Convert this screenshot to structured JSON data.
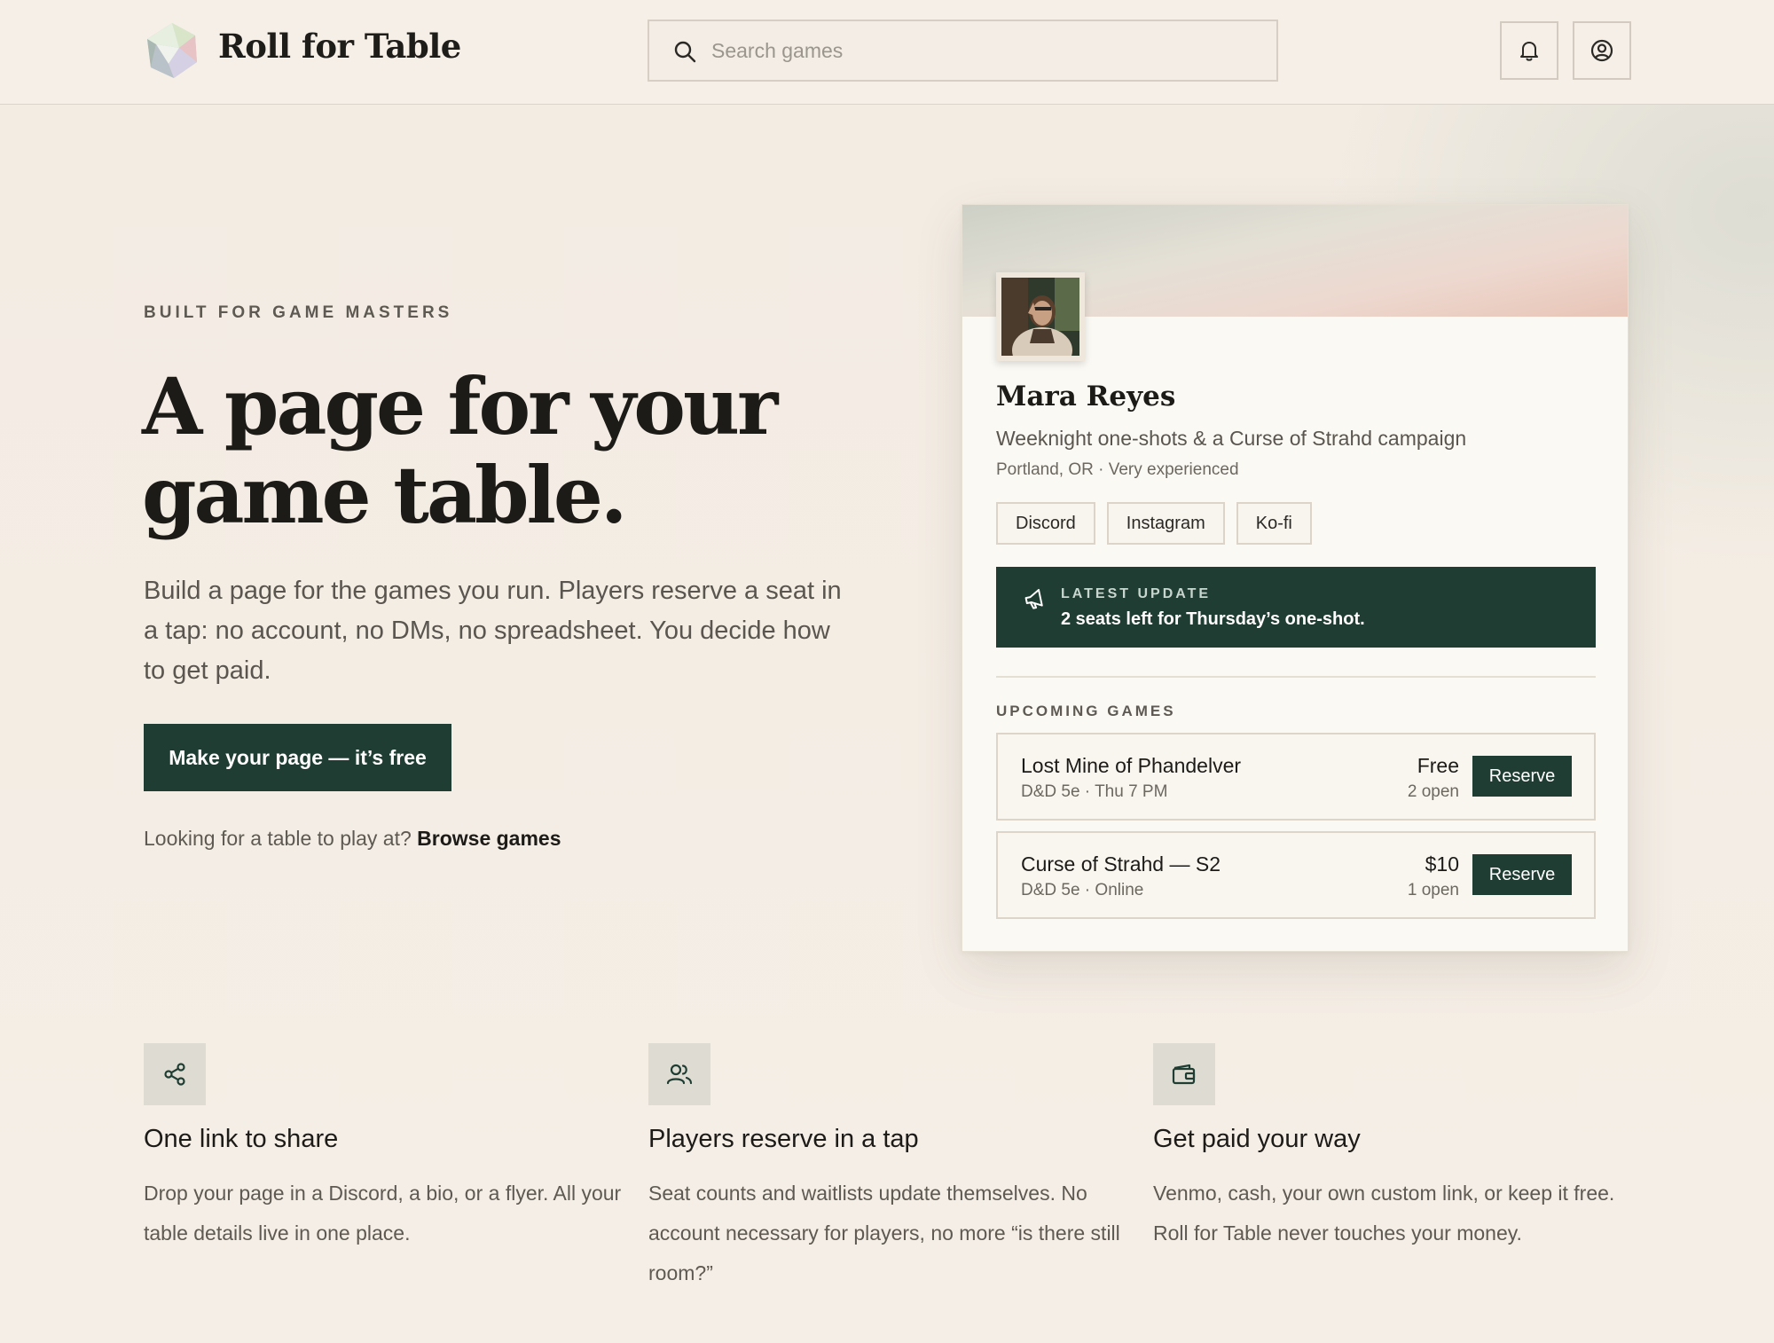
{
  "header": {
    "brand": "Roll for Table",
    "search_placeholder": "Search games"
  },
  "hero": {
    "eyebrow": "BUILT FOR GAME MASTERS",
    "title_line1": "A page for your",
    "title_line2": "game table.",
    "subtitle": "Build a page for the games you run. Players reserve a seat in a tap: no account, no DMs, no spreadsheet. You decide how to get paid.",
    "cta_label": "Make your page — it’s free",
    "browse_prompt": "Looking for a table to play at?",
    "browse_link": "Browse games"
  },
  "profile": {
    "name": "Mara Reyes",
    "tagline": "Weeknight one-shots & a Curse of Strahd campaign",
    "meta": "Portland, OR · Very experienced",
    "links": [
      "Discord",
      "Instagram",
      "Ko-fi"
    ],
    "update_label": "LATEST UPDATE",
    "update_text": "2 seats left for Thursday’s one-shot.",
    "upcoming_label": "UPCOMING GAMES",
    "games": [
      {
        "title": "Lost Mine of Phandelver",
        "sub": "D&D 5e · Thu 7 PM",
        "price": "Free",
        "open": "2 open",
        "action": "Reserve"
      },
      {
        "title": "Curse of Strahd — S2",
        "sub": "D&D 5e · Online",
        "price": "$10",
        "open": "1 open",
        "action": "Reserve"
      }
    ]
  },
  "features": [
    {
      "icon": "share-icon",
      "title": "One link to share",
      "desc": "Drop your page in a Discord, a bio, or a flyer. All your table details live in one place."
    },
    {
      "icon": "users-icon",
      "title": "Players reserve in a tap",
      "desc": "Seat counts and waitlists update themselves. No account necessary for players, no more “is there still room?”"
    },
    {
      "icon": "wallet-icon",
      "title": "Get paid your way",
      "desc": "Venmo, cash, your own custom link, or keep it free. Roll for Table never touches your money."
    }
  ],
  "colors": {
    "accent": "#1f3d33",
    "background": "#f4ede4",
    "card": "#fbf9f4"
  }
}
